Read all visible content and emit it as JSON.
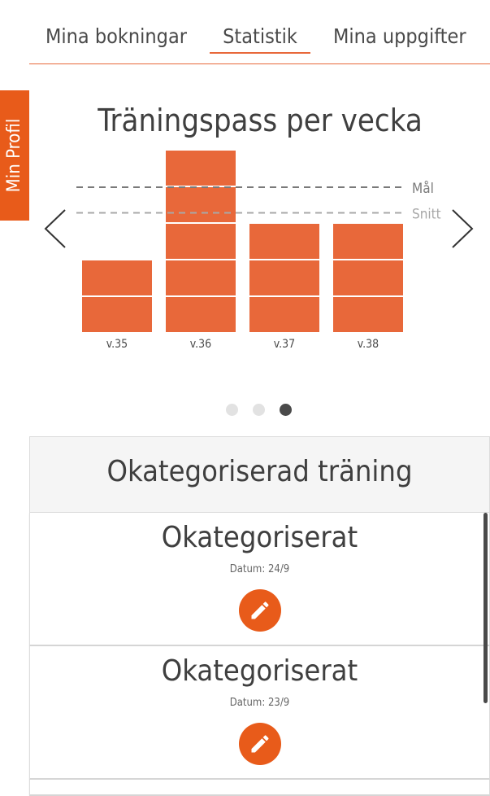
{
  "tabs": [
    {
      "label": "Mina bokningar"
    },
    {
      "label": "Statistik"
    },
    {
      "label": "Mina uppgifter"
    }
  ],
  "side_tab": {
    "label": "Min Profil"
  },
  "colors": {
    "accent": "#e8683a",
    "bar": "#e8683a",
    "text": "#4a4a4a"
  },
  "icons": {
    "prev": "chevron-left-icon",
    "next": "chevron-right-icon",
    "edit": "pencil-icon"
  },
  "carousel": {
    "page_count": 3,
    "active_index": 2
  },
  "chart_data": {
    "type": "bar",
    "title": "Träningspass per vecka",
    "categories": [
      "v.35",
      "v.36",
      "v.37",
      "v.38"
    ],
    "values": [
      2,
      5,
      3,
      3
    ],
    "reference_lines": [
      {
        "label": "Mål",
        "value": 4
      },
      {
        "label": "Snitt",
        "value": 3.3
      }
    ],
    "ylim": [
      0,
      5
    ]
  },
  "list": {
    "title": "Okategoriserad träning",
    "items": [
      {
        "title": "Okategoriserat",
        "date": "Datum: 24/9"
      },
      {
        "title": "Okategoriserat",
        "date": "Datum: 23/9"
      }
    ]
  }
}
